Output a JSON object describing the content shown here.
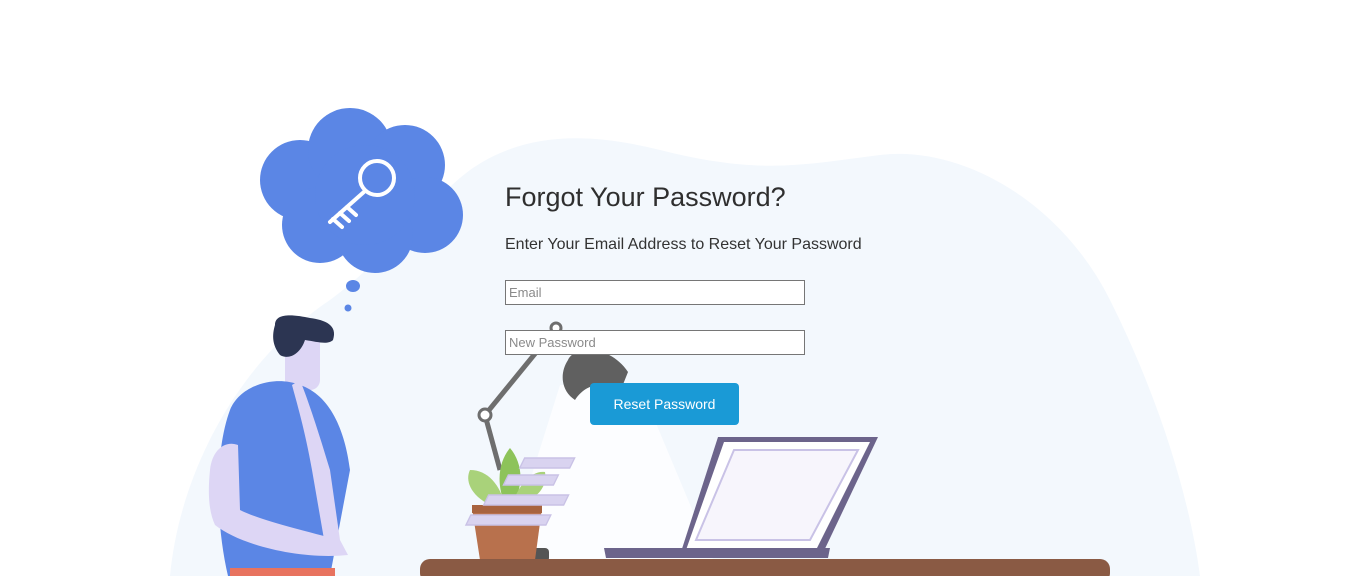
{
  "form": {
    "title": "Forgot Your Password?",
    "subtitle": "Enter Your Email Address to Reset Your Password",
    "email_placeholder": "Email",
    "email_value": "",
    "password_placeholder": "New Password",
    "password_value": "",
    "submit_label": "Reset Password"
  },
  "illustration": {
    "thought_icon": "key-icon",
    "colors": {
      "backdrop": "#f3f8fd",
      "cloud": "#5b86e5",
      "shirt": "#5b86e5",
      "hair": "#2c3552",
      "skin": "#ddd6f5",
      "desk": "#8a5a44",
      "pot": "#b8714d",
      "leaf": "#8dc35a",
      "laptop": "#6c648b",
      "lamp": "#606060"
    }
  },
  "accent_color": "#1a9ad6"
}
